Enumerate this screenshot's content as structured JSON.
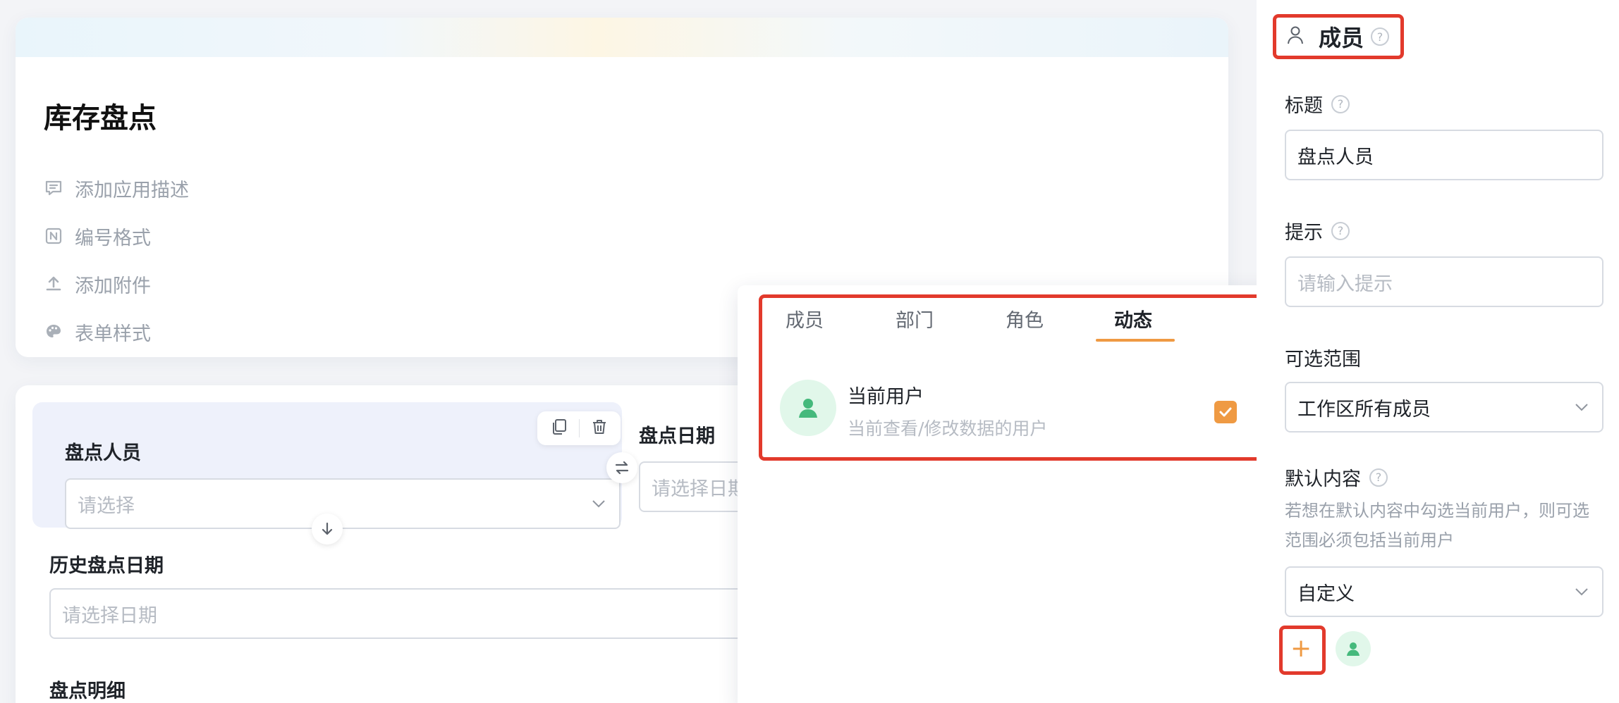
{
  "app": {
    "title": "库存盘点",
    "meta_items": [
      {
        "label": "添加应用描述",
        "icon": "comment-icon"
      },
      {
        "label": "编号格式",
        "icon": "number-format-icon"
      },
      {
        "label": "添加附件",
        "icon": "upload-icon"
      },
      {
        "label": "表单样式",
        "icon": "palette-icon"
      }
    ]
  },
  "form": {
    "fields": [
      {
        "label": "盘点人员",
        "placeholder": "请选择"
      },
      {
        "label": "盘点日期",
        "placeholder": "请选择日期"
      },
      {
        "label": "历史盘点日期",
        "placeholder": "请选择日期"
      },
      {
        "label": "盘点明细"
      }
    ],
    "toolbar_icons": [
      "copy-icon",
      "delete-icon"
    ]
  },
  "popover": {
    "tabs": [
      "成员",
      "部门",
      "角色",
      "动态"
    ],
    "active_tab": "动态",
    "option": {
      "name": "当前用户",
      "description": "当前查看/修改数据的用户",
      "checked": true
    }
  },
  "panel": {
    "component_name": "成员",
    "title_label": "标题",
    "title_value": "盘点人员",
    "hint_label": "提示",
    "hint_placeholder": "请输入提示",
    "range_label": "可选范围",
    "range_value": "工作区所有成员",
    "default_label": "默认内容",
    "default_desc": "若想在默认内容中勾选当前用户，则可选范围必须包括当前用户",
    "default_value": "自定义",
    "add_symbol": "+"
  },
  "colors": {
    "accent": "#ef9a43",
    "highlight": "#e23a2c",
    "avatar_green": "#45b97c"
  }
}
